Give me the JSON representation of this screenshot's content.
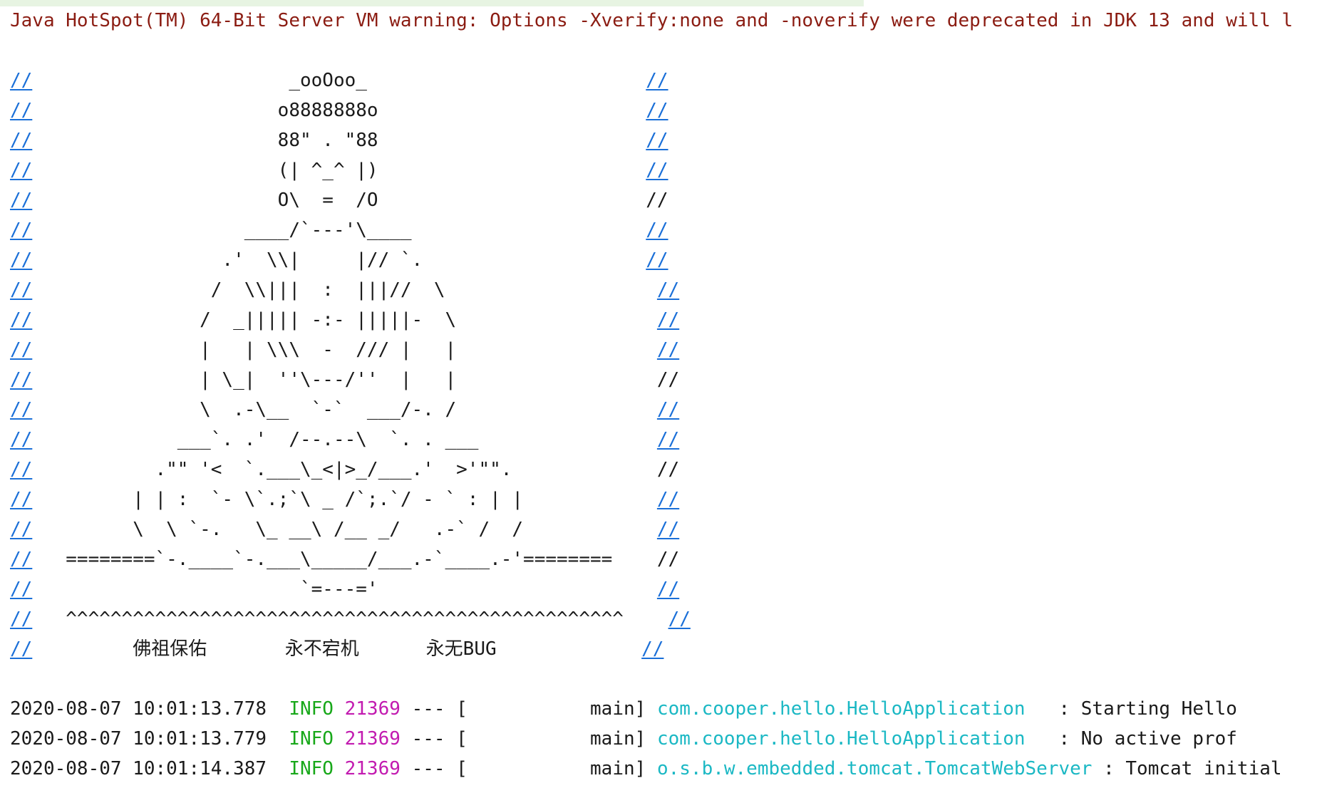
{
  "warning": "Java HotSpot(TM) 64-Bit Server VM warning: Options -Xverify:none and -noverify were deprecated in JDK 13 and will l",
  "banner": {
    "border": "///////////////////////////////////////////////////////////////",
    "lines": [
      {
        "left": "//",
        "art": "                       _ooOoo_                         ",
        "right": "//",
        "right_link": true
      },
      {
        "left": "//",
        "art": "                      o8888888o                        ",
        "right": "//",
        "right_link": true
      },
      {
        "left": "//",
        "art": "                      88\" . \"88                        ",
        "right": "//",
        "right_link": true
      },
      {
        "left": "//",
        "art": "                      (| ^_^ |)                        ",
        "right": "//",
        "right_link": true
      },
      {
        "left": "//",
        "art": "                      O\\  =  /O                        ",
        "right": "//",
        "right_link": false
      },
      {
        "left": "//",
        "art": "                   ____/`---'\\____                     ",
        "right": "//",
        "right_link": true
      },
      {
        "left": "//",
        "art": "                 .'  \\\\|     |// `.                    ",
        "right": "//",
        "right_link": true
      },
      {
        "left": "//",
        "art": "                /  \\\\|||  :  |||//  \\                   ",
        "right": "//",
        "right_link": true
      },
      {
        "left": "//",
        "art": "               /  _||||| -:- |||||-  \\                  ",
        "right": "//",
        "right_link": true
      },
      {
        "left": "//",
        "art": "               |   | \\\\\\  -  /// |   |                  ",
        "right": "//",
        "right_link": true
      },
      {
        "left": "//",
        "art": "               | \\_|  ''\\---/''  |   |                  ",
        "right": "//",
        "right_link": false
      },
      {
        "left": "//",
        "art": "               \\  .-\\__  `-`  ___/-. /                  ",
        "right": "//",
        "right_link": true
      },
      {
        "left": "//",
        "art": "             ___`. .'  /--.--\\  `. . ___                ",
        "right": "//",
        "right_link": true
      },
      {
        "left": "//",
        "art": "           .\"\" '<  `.___\\_<|>_/___.'  >'\"\".             ",
        "right": "//",
        "right_link": false
      },
      {
        "left": "//",
        "art": "         | | :  `- \\`.;`\\ _ /`;.`/ - ` : | |            ",
        "right": "//",
        "right_link": true
      },
      {
        "left": "//",
        "art": "         \\  \\ `-.   \\_ __\\ /__ _/   .-` /  /            ",
        "right": "//",
        "right_link": true
      },
      {
        "left": "//",
        "art": "   ========`-.____`-.___\\_____/___.-`____.-'========    ",
        "right": "//",
        "right_link": false
      },
      {
        "left": "//",
        "art": "                        `=---='                         ",
        "right": "//",
        "right_link": true
      },
      {
        "left": "//",
        "art": "   ^^^^^^^^^^^^^^^^^^^^^^^^^^^^^^^^^^^^^^^^^^^^^^^^^^    ",
        "right": "//",
        "right_link": true
      },
      {
        "left": "//",
        "art": "         佛祖保佑       永不宕机      永无BUG             ",
        "right": "//",
        "right_link": true
      }
    ]
  },
  "logs": [
    {
      "timestamp": "2020-08-07 10:01:13.778",
      "level": "INFO",
      "pid": "21369",
      "sep": "---",
      "thread": "[           main]",
      "logger": "com.cooper.hello.HelloApplication",
      "message": "   : Starting Hello"
    },
    {
      "timestamp": "2020-08-07 10:01:13.779",
      "level": "INFO",
      "pid": "21369",
      "sep": "---",
      "thread": "[           main]",
      "logger": "com.cooper.hello.HelloApplication",
      "message": "   : No active prof"
    },
    {
      "timestamp": "2020-08-07 10:01:14.387",
      "level": "INFO",
      "pid": "21369",
      "sep": "---",
      "thread": "[           main]",
      "logger": "o.s.b.w.embedded.tomcat.TomcatWebServer",
      "message": " : Tomcat initial"
    }
  ],
  "colors": {
    "warning": "#8b1c12",
    "link": "#1a6fd8",
    "info": "#18a81a",
    "pid": "#c21bb0",
    "logger": "#1bb8c4"
  }
}
